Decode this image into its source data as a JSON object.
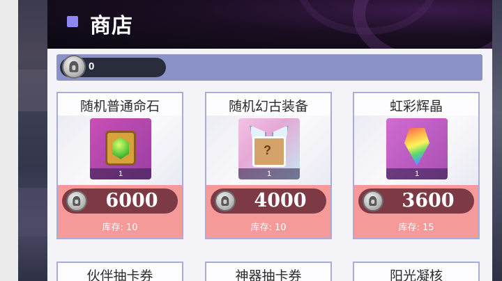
{
  "header": {
    "title": "商店",
    "accent_color": "#8f86f2"
  },
  "currency": {
    "icon": "helmet-coin-icon",
    "amount": "0"
  },
  "items": [
    {
      "name": "随机普通命石",
      "icon": "green-gem-icon",
      "count": "1",
      "price": "6000",
      "stock": "库存: 10"
    },
    {
      "name": "随机幻古装备",
      "icon": "mystery-box-icon",
      "count": "1",
      "price": "4000",
      "stock": "库存: 10"
    },
    {
      "name": "虹彩辉晶",
      "icon": "rainbow-crystal-icon",
      "count": "1",
      "price": "3600",
      "stock": "库存: 15"
    },
    {
      "name": "伙伴抽卡券"
    },
    {
      "name": "神器抽卡券"
    },
    {
      "name": "阳光凝核"
    }
  ],
  "colors": {
    "card_border": "#a7acd8",
    "price_background": "#f59a98",
    "price_pill": "#7d3a44",
    "currency_bar": "#8b92c8"
  }
}
